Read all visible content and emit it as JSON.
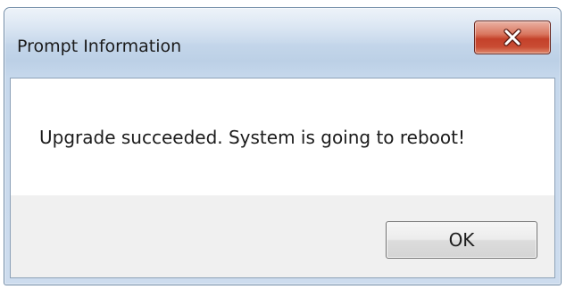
{
  "window": {
    "title": "Prompt Information"
  },
  "message": {
    "text": "Upgrade succeeded. System is going to reboot!"
  },
  "buttons": {
    "ok_label": "OK"
  },
  "icons": {
    "close": "close-icon"
  }
}
